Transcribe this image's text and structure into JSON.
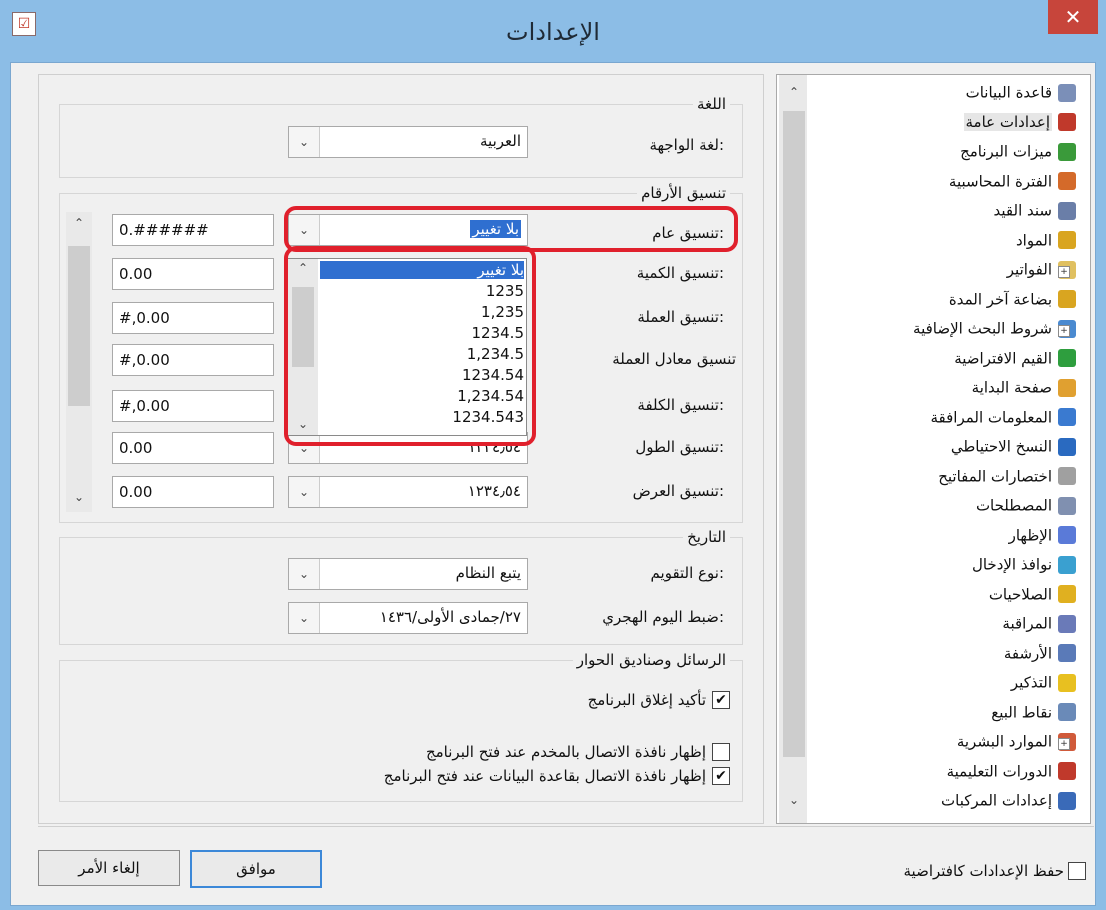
{
  "window": {
    "title": "الإعدادات",
    "close_glyph": "✕",
    "app_icon": "settings-check-icon"
  },
  "language_group": {
    "title": "اللغة",
    "interface_language_label": "لغة الواجهة:",
    "interface_language_value": "العربية"
  },
  "number_format_group": {
    "title": "تنسيق الأرقام",
    "rows": [
      {
        "label": "تنسيق عام:",
        "combo_value": "بلا تغيير",
        "text_value": "0.######"
      },
      {
        "label": "تنسيق الكمية:",
        "combo_value": "",
        "text_value": "0.00"
      },
      {
        "label": "تنسيق العملة:",
        "combo_value": "",
        "text_value": "#,0.00"
      },
      {
        "label": "تنسيق معادل العملة",
        "combo_value": "",
        "text_value": "#,0.00"
      },
      {
        "label": "تنسيق الكلفة:",
        "combo_value": "",
        "text_value": "#,0.00"
      },
      {
        "label": "تنسيق الطول:",
        "combo_value": "١٢٣٤٫٥٤",
        "text_value": "0.00"
      },
      {
        "label": "تنسيق العرض:",
        "combo_value": "١٢٣٤٫٥٤",
        "text_value": "0.00"
      }
    ],
    "dropdown_options": [
      "بلا تغيير",
      "1235",
      "1,235",
      "1234.5",
      "1,234.5",
      "1234.54",
      "1,234.54",
      "1234.543"
    ],
    "dropdown_selected": "بلا تغيير"
  },
  "date_group": {
    "title": "التاريخ",
    "calendar_type_label": "نوع التقويم:",
    "calendar_type_value": "يتبع النظام",
    "hijri_adjust_label": "ضبط اليوم الهجري:",
    "hijri_adjust_value": "٢٧/جمادى الأولى/١٤٣٦"
  },
  "messages_group": {
    "title": "الرسائل وصناديق الحوار",
    "options": [
      {
        "label": "تأكيد إغلاق البرنامج",
        "checked": true
      },
      {
        "label": "إظهار نافذة الاتصال بالمخدم عند فتح البرنامج",
        "checked": false
      },
      {
        "label": "إظهار نافذة الاتصال بقاعدة البيانات عند فتح البرنامج",
        "checked": true
      }
    ]
  },
  "tree": {
    "items": [
      {
        "label": "قاعدة البيانات",
        "icon": "database-icon",
        "color": "#7b8fb8",
        "expander": false
      },
      {
        "label": "إعدادات عامة",
        "icon": "settings-check-icon",
        "color": "#c0392b",
        "expander": false
      },
      {
        "label": "ميزات البرنامج",
        "icon": "puzzle-icon",
        "color": "#3a9a3a",
        "expander": false
      },
      {
        "label": "الفترة المحاسبية",
        "icon": "calendar-icon",
        "color": "#d46a2a",
        "expander": false
      },
      {
        "label": "سند القيد",
        "icon": "document-icon",
        "color": "#6a7ea8",
        "expander": false
      },
      {
        "label": "المواد",
        "icon": "box-icon",
        "color": "#d9a520",
        "expander": false
      },
      {
        "label": "الفواتير",
        "icon": "invoice-icon",
        "color": "#e0c060",
        "expander": true
      },
      {
        "label": "بضاعة آخر المدة",
        "icon": "box-icon",
        "color": "#d9a520",
        "expander": false
      },
      {
        "label": "شروط البحث الإضافية",
        "icon": "search-icon",
        "color": "#4a8ad0",
        "expander": true
      },
      {
        "label": "القيم الافتراضية",
        "icon": "check-circle-icon",
        "color": "#2e9e3e",
        "expander": false
      },
      {
        "label": "صفحة البداية",
        "icon": "home-icon",
        "color": "#e0a030",
        "expander": false
      },
      {
        "label": "المعلومات المرافقة",
        "icon": "info-icon",
        "color": "#3a7ad0",
        "expander": false
      },
      {
        "label": "النسخ الاحتياطي",
        "icon": "backup-icon",
        "color": "#2a6ac0",
        "expander": false
      },
      {
        "label": "اختصارات المفاتيح",
        "icon": "keyboard-icon",
        "color": "#a0a0a0",
        "expander": false
      },
      {
        "label": "المصطلحات",
        "icon": "glossary-icon",
        "color": "#8090b0",
        "expander": false
      },
      {
        "label": "الإظهار",
        "icon": "display-icon",
        "color": "#5a7ad8",
        "expander": false
      },
      {
        "label": "نوافذ الإدخال",
        "icon": "edit-window-icon",
        "color": "#3aa0d0",
        "expander": false
      },
      {
        "label": "الصلاحيات",
        "icon": "lock-icon",
        "color": "#e0b020",
        "expander": false
      },
      {
        "label": "المراقبة",
        "icon": "monitor-icon",
        "color": "#6a7ab8",
        "expander": false
      },
      {
        "label": "الأرشفة",
        "icon": "paperclip-icon",
        "color": "#5a7ab8",
        "expander": false
      },
      {
        "label": "التذكير",
        "icon": "bell-icon",
        "color": "#e8c020",
        "expander": false
      },
      {
        "label": "نقاط البيع",
        "icon": "pos-icon",
        "color": "#6a8ab8",
        "expander": false
      },
      {
        "label": "الموارد البشرية",
        "icon": "person-icon",
        "color": "#d05a3a",
        "expander": true
      },
      {
        "label": "الدورات التعليمية",
        "icon": "settings-check-icon",
        "color": "#c0392b",
        "expander": false
      },
      {
        "label": "إعدادات المركبات",
        "icon": "car-icon",
        "color": "#3a6ab8",
        "expander": false
      }
    ],
    "selected_index": 1
  },
  "footer": {
    "save_default_label": "حفظ الإعدادات كافتراضية",
    "save_default_checked": false,
    "ok_label": "موافق",
    "cancel_label": "إلغاء الأمر"
  }
}
